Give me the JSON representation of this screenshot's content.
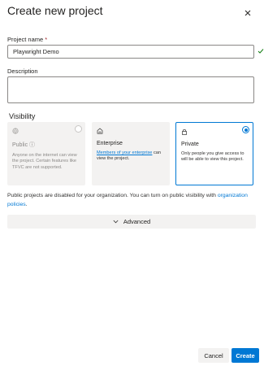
{
  "dialog": {
    "title": "Create new project"
  },
  "form": {
    "project_name_label": "Project name",
    "required_marker": "*",
    "project_name_value": "Playwright Demo",
    "description_label": "Description",
    "description_value": ""
  },
  "visibility": {
    "label": "Visibility",
    "options": [
      {
        "name": "Public",
        "icon": "globe-icon",
        "description": "Anyone on the internet can view the project. Certain features like TFVC are not supported.",
        "disabled": true,
        "selected": false
      },
      {
        "name": "Enterprise",
        "icon": "building-icon",
        "link_text": "Members of your enterprise",
        "description_after": "can view the project.",
        "disabled": false,
        "selected": false
      },
      {
        "name": "Private",
        "icon": "lock-icon",
        "description": "Only people you give access to will be able to view this project.",
        "disabled": false,
        "selected": true
      }
    ]
  },
  "notice": {
    "text": "Public projects are disabled for your organization. You can turn on public visibility with",
    "link_text": "organization policies",
    "suffix": "."
  },
  "advanced": {
    "label": "Advanced"
  },
  "buttons": {
    "cancel": "Cancel",
    "create": "Create"
  },
  "colors": {
    "accent": "#0078d4",
    "panel": "#f3f2f1",
    "required": "#a4262c"
  }
}
